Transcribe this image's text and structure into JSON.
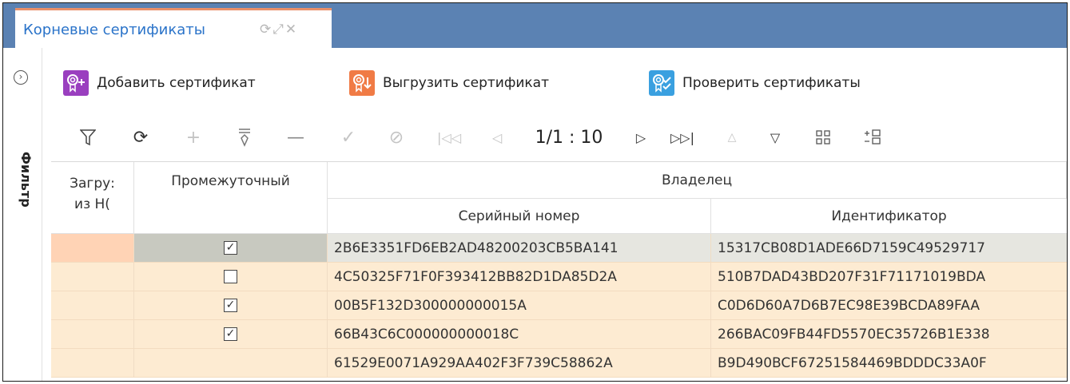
{
  "tab": {
    "title": "Корневые сертификаты",
    "icons": [
      "refresh-icon",
      "expand-icon",
      "close-icon"
    ]
  },
  "filter": {
    "label": "Фильтр",
    "toggle_icon": "chevron-right-circle-icon"
  },
  "actions": [
    {
      "label": "Добавить сертификат",
      "icon": "certificate-add-icon",
      "color": "#9a3fbf"
    },
    {
      "label": "Выгрузить сертификат",
      "icon": "certificate-export-icon",
      "color": "#f07b45"
    },
    {
      "label": "Проверить сертификаты",
      "icon": "certificate-check-icon",
      "color": "#3aa0e0"
    }
  ],
  "toolbar": {
    "pager": "1/1 : 10",
    "icons": [
      "filter-icon",
      "refresh-icon",
      "add-icon",
      "edit-icon",
      "delete-icon",
      "confirm-icon",
      "cancel-icon",
      "first-page-icon",
      "prev-page-icon",
      "next-page-icon",
      "last-page-icon",
      "sort-up-icon",
      "sort-down-icon",
      "columns-icon",
      "grouping-icon"
    ]
  },
  "grid": {
    "headers": {
      "loaded": "Загру:\nиз Н(",
      "intermediate": "Промежуточный",
      "owner": "Владелец",
      "serial": "Серийный номер",
      "identifier": "Идентификатор"
    },
    "rows": [
      {
        "intermediate": true,
        "serial": "2B6E3351FD6EB2AD48200203CB5BA141",
        "identifier": "15317CB08D1ADE66D7159C49529717",
        "selected": true
      },
      {
        "intermediate": false,
        "serial": "4C50325F71F0F393412BB82D1DA85D2A",
        "identifier": "510B7DAD43BD207F31F71171019BDA"
      },
      {
        "intermediate": true,
        "serial": "00B5F132D300000000015A",
        "identifier": "C0D6D60A7D6B7EC98E39BCDA89FAA"
      },
      {
        "intermediate": true,
        "serial": "66B43C6C000000000018C",
        "identifier": "266BAC09FB44FD5570EC35726B1E338"
      },
      {
        "intermediate": null,
        "serial": "61529E0071A929AA402F3F739C58862A",
        "identifier": "B9D490BCF67251584469BDDDC33A0F"
      }
    ]
  }
}
